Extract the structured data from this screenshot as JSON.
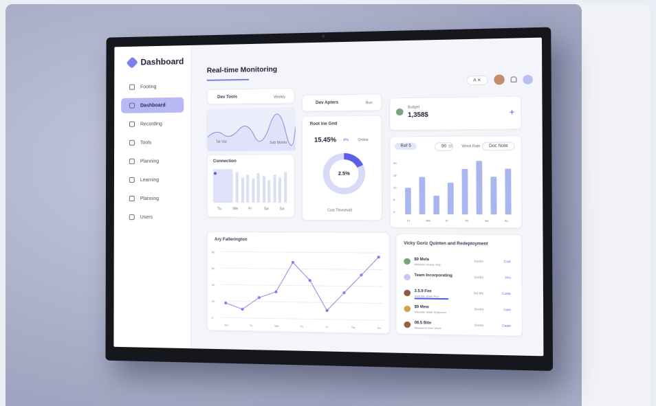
{
  "sidebar": {
    "brand": "Dashboard",
    "items": [
      {
        "label": "Footing",
        "active": false
      },
      {
        "label": "Dashboard",
        "active": true
      },
      {
        "label": "Recording",
        "active": false
      },
      {
        "label": "Tools",
        "active": false
      },
      {
        "label": "Planning",
        "active": false
      },
      {
        "label": "Learning",
        "active": false
      },
      {
        "label": "Planning",
        "active": false
      },
      {
        "label": "Users",
        "active": false
      }
    ]
  },
  "header": {
    "title": "Real-time Monitoring",
    "pill": "A  ✕"
  },
  "cards": {
    "top_left": {
      "label": "Dev Tools",
      "tag": "Weekly",
      "left_caption": "Tai Vac",
      "right_caption": "Sub Monto"
    },
    "top_mid": {
      "label": "Dev Apters",
      "tag": "Run"
    },
    "top_right": {
      "small": "Budget",
      "value": "1,358$"
    },
    "connection": {
      "label": "Connection",
      "axis": [
        "Tu",
        "We",
        "Fr",
        "Sa",
        "Sa"
      ]
    },
    "rate": {
      "label": "Root Ine Gnd",
      "value": "15.45%",
      "delta": "4%",
      "tag": "Online",
      "center": "2.5%",
      "legend": "Cost Threshold"
    },
    "bars_right": {
      "pill": "Ref 5",
      "tabs": [
        "90",
        "10",
        "Week Rate"
      ],
      "tag": "Doc Note",
      "axis": [
        "Tu",
        "We",
        "Fr",
        "Th",
        "Sa",
        "Su"
      ],
      "y_ticks": [
        "20",
        "16",
        "12",
        "8",
        "4"
      ],
      "values": [
        10,
        14,
        7,
        12,
        17,
        20,
        14,
        17
      ]
    },
    "line": {
      "label": "Ary Falterington",
      "axis": [
        "Mo",
        "Tu",
        "We",
        "Th",
        "Fr",
        "Sa",
        "Su"
      ],
      "y_ticks": [
        "80",
        "60",
        "40",
        "20",
        "0"
      ],
      "values": [
        2,
        1,
        3,
        4,
        9,
        6,
        1,
        4,
        7,
        10
      ]
    },
    "list": {
      "title": "Vicky Goriz Quinten and Redeployment",
      "rows": [
        {
          "title": "$9 Mela",
          "sub": "Website Heavy Ship",
          "c1": "Socks",
          "c2": "Cost",
          "color": "#7aa37b"
        },
        {
          "title": "Team Incorporating",
          "sub": "",
          "c1": "Socks",
          "c2": "Viro",
          "color": "#c7c9f2"
        },
        {
          "title": "3.5.9 Fee",
          "sub": "Website Stats Run",
          "c1": "Da Ms",
          "c2": "Coste",
          "color": "#8a5a44",
          "progress": 0.6
        },
        {
          "title": "$9 Mew",
          "sub": "Website Stats Shipment",
          "c1": "Socks",
          "c2": "Care",
          "color": "#d6a24a"
        },
        {
          "title": "08.5 Bite",
          "sub": "Research Dev Work",
          "c1": "Socks",
          "c2": "Caste",
          "color": "#9b5f49"
        }
      ]
    }
  }
}
